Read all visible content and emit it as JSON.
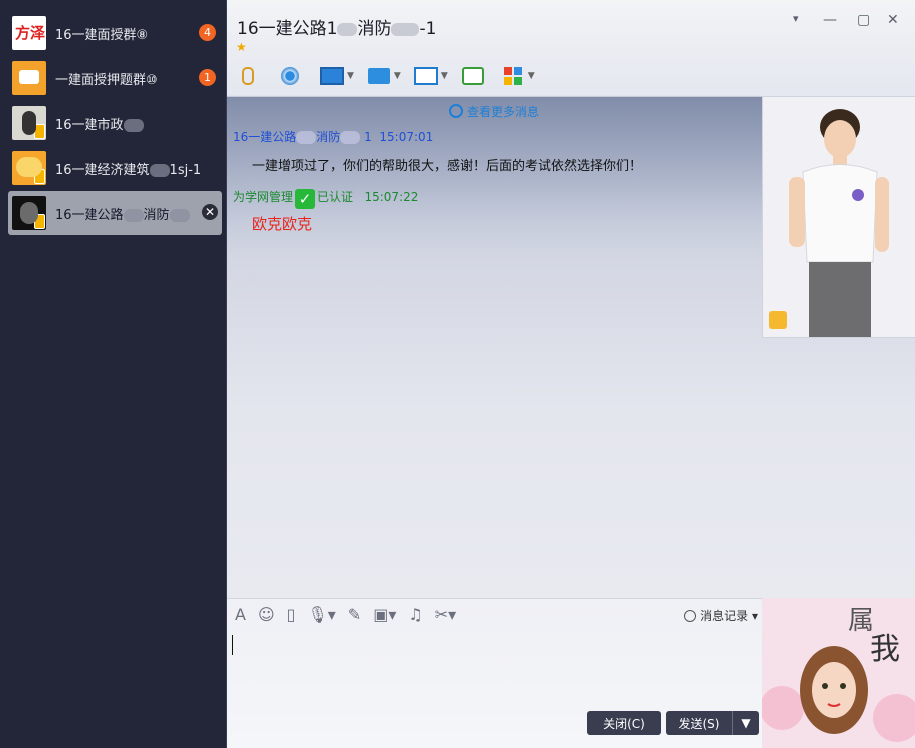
{
  "sidebar": {
    "conversations": [
      {
        "name": "16一建面授群⑧",
        "badge": "4",
        "active": false
      },
      {
        "name": "一建面授押题群⑩",
        "badge": "1",
        "active": false
      },
      {
        "name": "16一建市政",
        "badge": "",
        "active": false
      },
      {
        "name": "16一建经济建筑",
        "suffix": "1sj-1",
        "badge": "",
        "active": false
      },
      {
        "name": "16一建公路",
        "suffix": "消防",
        "badge": "",
        "active": true
      }
    ],
    "avatar_text_1": "方泽"
  },
  "header": {
    "title_part1": "16一建公路1",
    "title_part2": "消防",
    "title_part3": "-1",
    "star": "★",
    "win_dropdown": "▾",
    "win_minimize": "—",
    "win_maximize": "▢",
    "win_close": "✕"
  },
  "chat": {
    "view_more": "查看更多消息",
    "messages": [
      {
        "sender_a": "16一建公路",
        "sender_b": "消防",
        "sender_c": "1",
        "time": "15:07:01",
        "text": "一建增项过了，你们的帮助很大，感谢！后面的考试依然选择你们！"
      },
      {
        "sender": "为学网管理",
        "verified": "已认证",
        "time": "15:07:22",
        "text": "欧克欧克"
      }
    ]
  },
  "input": {
    "history_label": "消息记录",
    "close_label": "关闭(C)",
    "send_label": "发送(S)"
  },
  "show_bottom": {
    "text_big": "属",
    "text_big2": "我"
  },
  "colors": {
    "sidebar_bg": "#232638",
    "badge": "#f26522",
    "sender_blue": "#1f4fd6",
    "sender_green": "#1a8a2e",
    "red_text": "#e8231a"
  }
}
